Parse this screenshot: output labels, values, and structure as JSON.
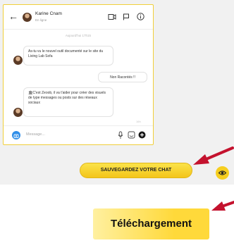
{
  "chat": {
    "contact_name": "Karine Cnam",
    "contact_status": "En ligne",
    "date_separator": "Aujourd'hui 17h15",
    "messages": [
      {
        "from": "contact",
        "text": "As-tu vu le nouvel outil documenté sur le site du Living Lab Sofa"
      },
      {
        "from": "me",
        "text": "Non Racontés !!"
      },
      {
        "from": "contact",
        "text": "C'est Zeoob, il va t'aider pour créer des visuels de type messages ou posts sur des réseaux sociaux"
      }
    ],
    "message_time": "16h",
    "input_placeholder": "Message..."
  },
  "actions": {
    "save_label": "SAUVEGARDEZ VOTRE CHAT",
    "download_label": "Téléchargement"
  },
  "colors": {
    "accent_yellow": "#f6ce1f",
    "arrow_red": "#c4122e",
    "camera_blue": "#2f8ee8"
  },
  "icons": [
    "back-arrow-icon",
    "video-icon",
    "flag-icon",
    "info-icon",
    "camera-icon",
    "mic-icon",
    "sticker-icon",
    "add-icon",
    "eye-icon"
  ]
}
